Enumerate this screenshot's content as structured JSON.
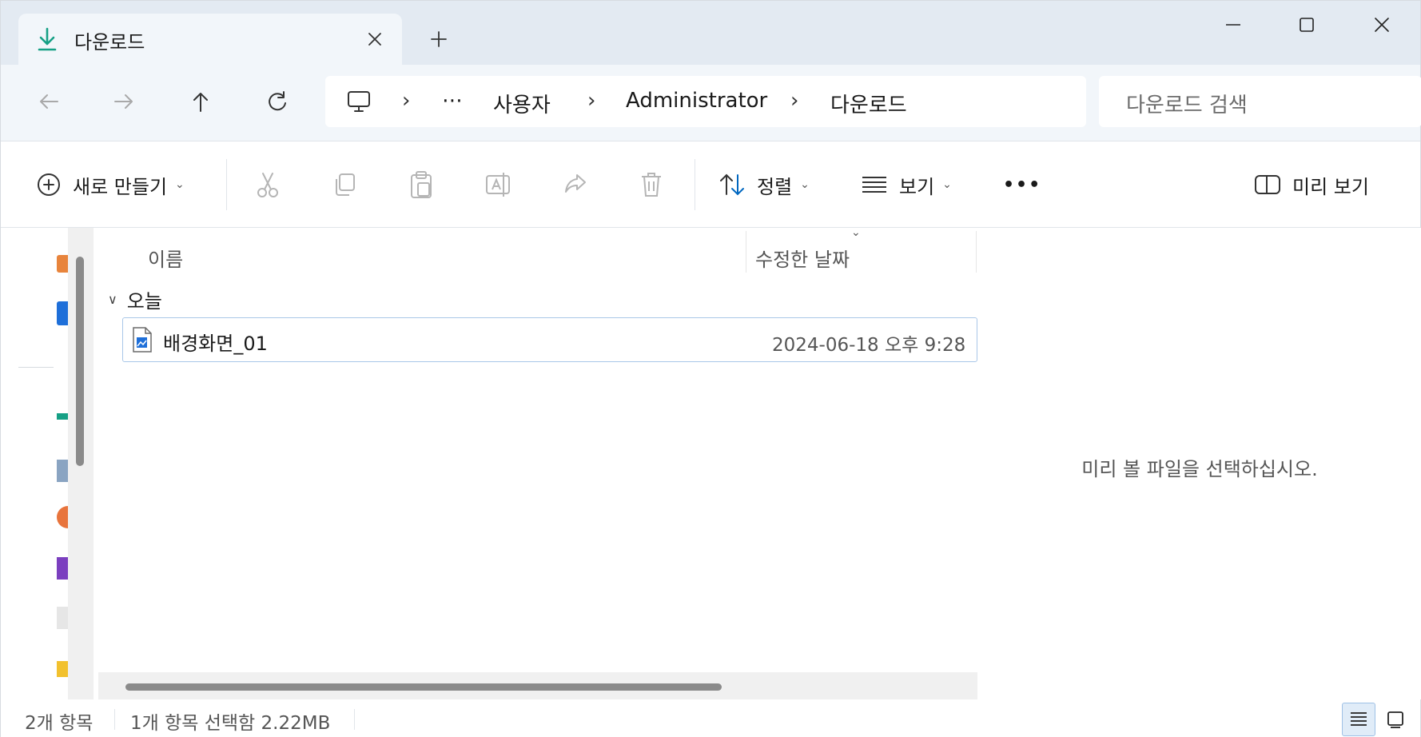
{
  "tab": {
    "title": "다운로드",
    "icon": "download-arrow-icon"
  },
  "navigation": {
    "breadcrumb": [
      "사용자",
      "Administrator",
      "다운로드"
    ],
    "overflow": "⋯",
    "separator": "›",
    "search_placeholder": "다운로드 검색"
  },
  "commands": {
    "new": "새로 만들기",
    "sort": "정렬",
    "view": "보기",
    "preview": "미리 보기",
    "more": "•••"
  },
  "file_list": {
    "columns": {
      "name": "이름",
      "modified": "수정한 날짜"
    },
    "groups": [
      {
        "label": "오늘",
        "items": [
          {
            "name": "배경화면_01",
            "modified": "2024-06-18 오후 9:28",
            "selected": true,
            "icon": "image-file-icon"
          }
        ]
      }
    ]
  },
  "preview_pane": {
    "message": "미리 볼 파일을 선택하십시오."
  },
  "status": {
    "item_count": "2개 항목",
    "selection": "1개 항목 선택함 2.22MB"
  },
  "colors": {
    "accent": "#0067c0",
    "download_icon": "#16a085",
    "selection_border": "#a9c7e8",
    "titlebar": "#e3eaf2"
  }
}
